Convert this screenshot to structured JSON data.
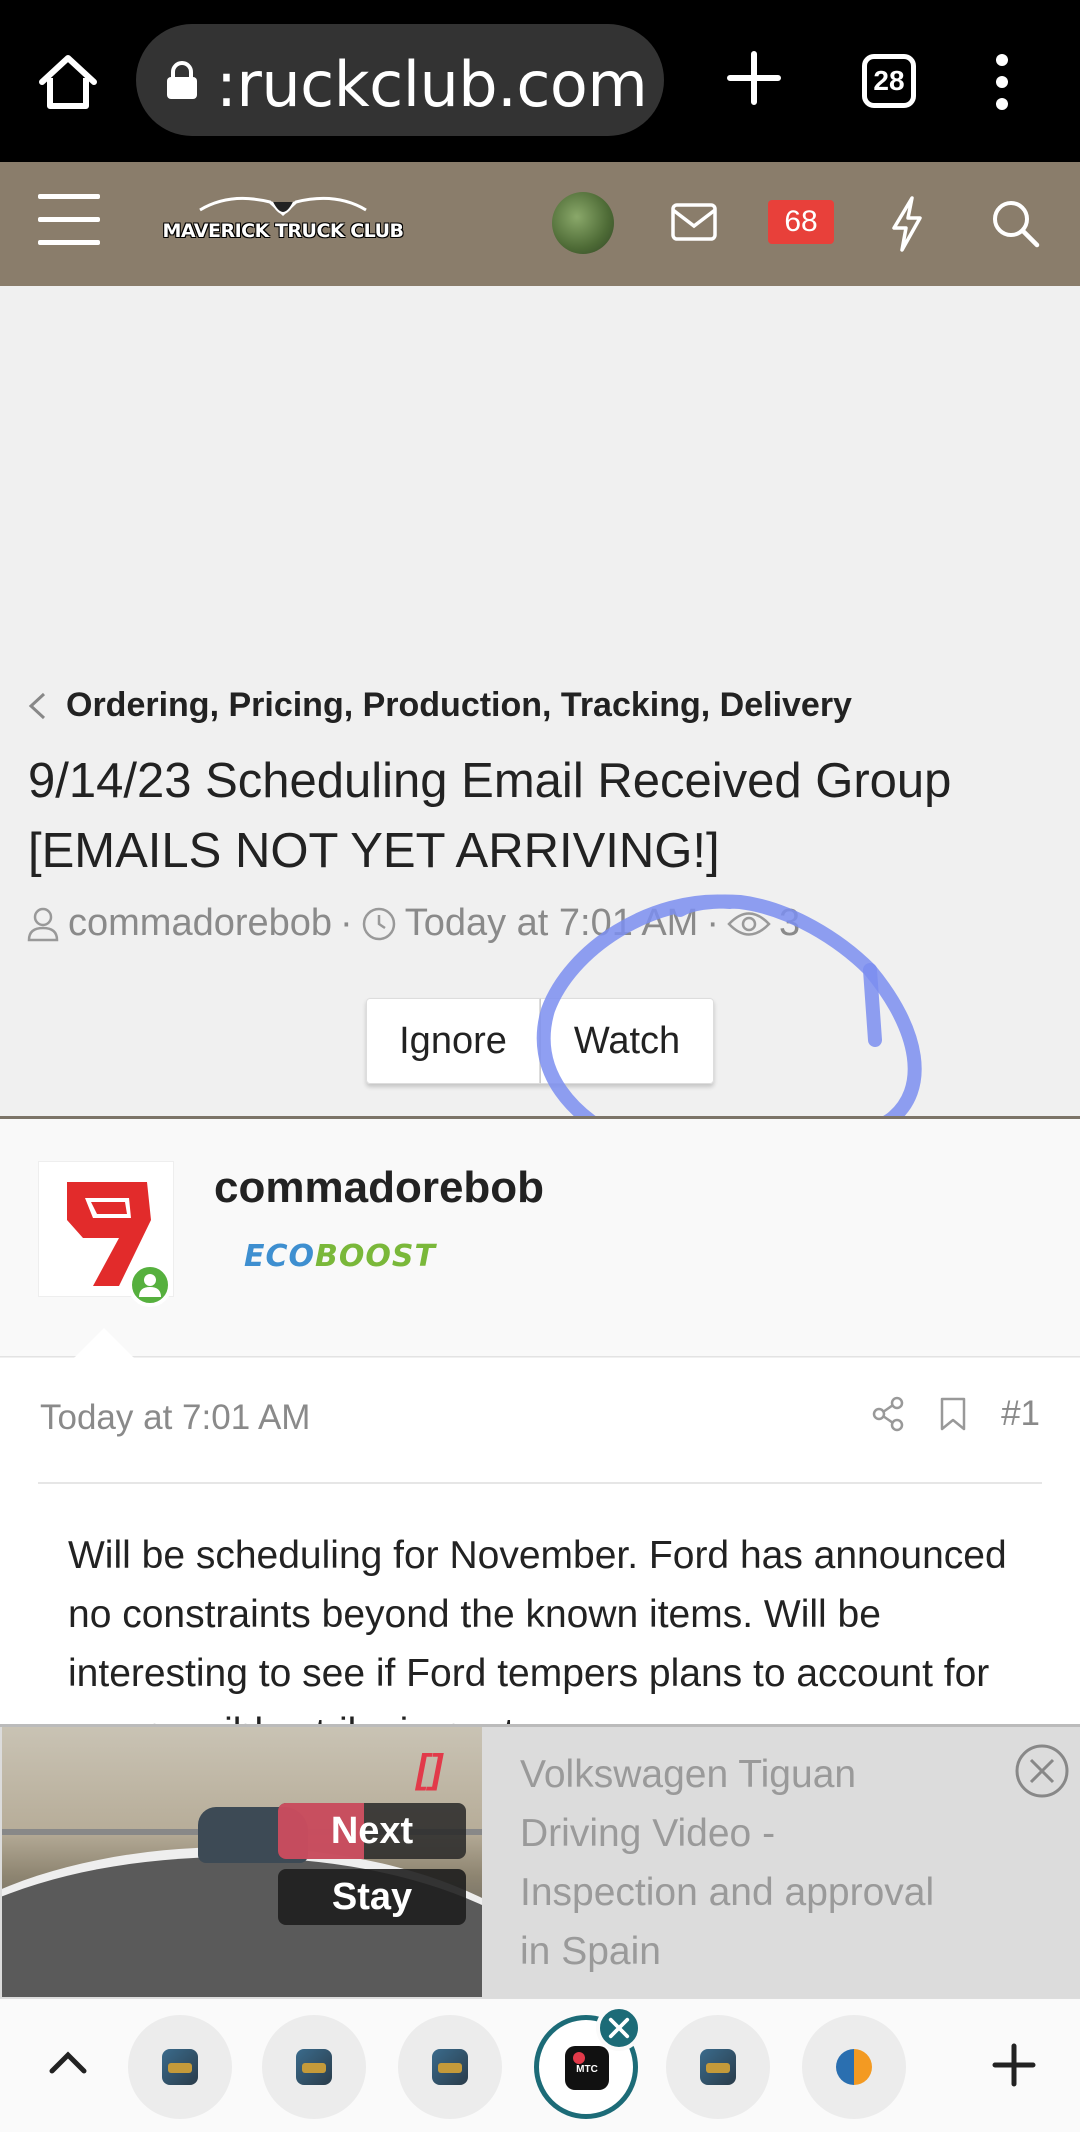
{
  "browser": {
    "url_text": ":ruckclub.com",
    "tabs_count": "28"
  },
  "site": {
    "logo_text": "MAVERICK TRUCK CLUB",
    "alerts_count": "68"
  },
  "thread": {
    "breadcrumb": "Ordering, Pricing, Production, Tracking, Delivery",
    "title": "9/14/23 Scheduling Email Received Group [EMAILS NOT YET ARRIVING!]",
    "author": "commadorebob",
    "time": "Today at 7:01 AM",
    "views": "3",
    "ignore_label": "Ignore",
    "watch_label": "Watch"
  },
  "post": {
    "username": "commadorebob",
    "banner_part1": "ECO",
    "banner_part2": "BOOST",
    "date": "Today at 7:01 AM",
    "number": "#1",
    "text": "Will be scheduling for November. Ford has announced no constraints beyond the known items. Will be interesting to see if Ford tempers plans to account for any possible strike impact."
  },
  "video_ad": {
    "title": "Volkswagen Tiguan Driving Video - Inspection and approval in Spain",
    "next_label": "Next",
    "stay_label": "Stay",
    "bracket": "[]"
  },
  "bottom_tabs": {
    "active_label": "MTC"
  },
  "colors": {
    "header_bg": "#8a7d6b",
    "alerts_badge": "#e8403a",
    "annotation_circle": "#7b8ef0",
    "active_tab_ring": "#1c6b77"
  }
}
